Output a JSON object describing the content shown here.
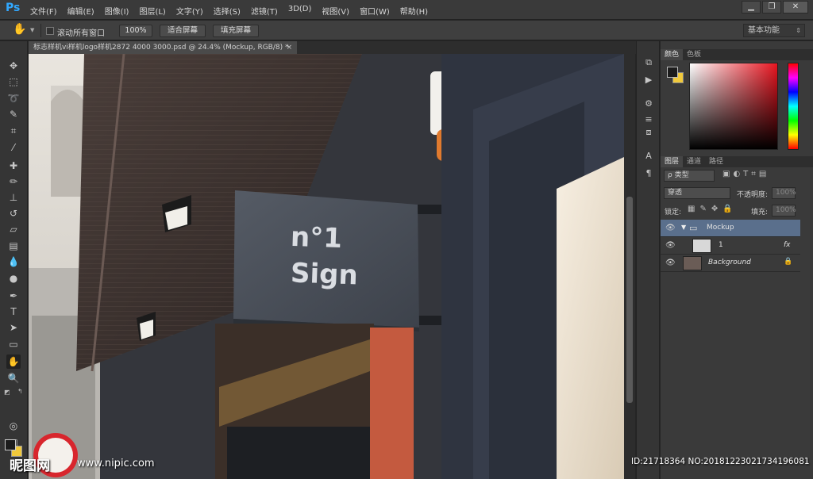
{
  "app": {
    "logo": "Ps"
  },
  "menu": [
    "文件(F)",
    "编辑(E)",
    "图像(I)",
    "图层(L)",
    "文字(Y)",
    "选择(S)",
    "滤镜(T)",
    "3D(D)",
    "视图(V)",
    "窗口(W)",
    "帮助(H)"
  ],
  "window_controls": {
    "minimize": "▁",
    "restore": "❐",
    "close": "✕"
  },
  "options": {
    "scroll_all_label": "滚动所有窗口",
    "zoom_100": "100%",
    "fit_screen": "适合屏幕",
    "fill_screen": "填充屏幕",
    "workspace": "基本功能"
  },
  "document": {
    "tab_title": "标志样机vi样机logo样机2872 4000 3000.psd @ 24.4% (Mockup, RGB/8) *",
    "close": "×"
  },
  "sign": {
    "line1": "n°1",
    "line2": "Sign"
  },
  "panels": {
    "color_tabs": [
      "颜色",
      "色板"
    ],
    "layers_tabs": [
      "图层",
      "通道",
      "路径"
    ],
    "filter_kind": "ρ 类型",
    "blend_mode": "穿透",
    "opacity_label": "不透明度:",
    "opacity_value": "100%",
    "lock_label": "锁定:",
    "fill_label": "填充:",
    "fill_value": "100%",
    "layers": [
      {
        "name": "Mockup",
        "kind": "group"
      },
      {
        "name": "1",
        "kind": "smart",
        "fx": "fx"
      },
      {
        "name": "Background",
        "kind": "background"
      }
    ]
  },
  "watermark": {
    "logo": "昵图网",
    "url": "www.nipic.com",
    "id": "ID:21718364 NO:20181223021734196081"
  },
  "colors": {
    "fg": "#1c1c1c",
    "bg": "#f0c93c",
    "accent": "#31a8ff",
    "sign": "#4a4f58"
  }
}
